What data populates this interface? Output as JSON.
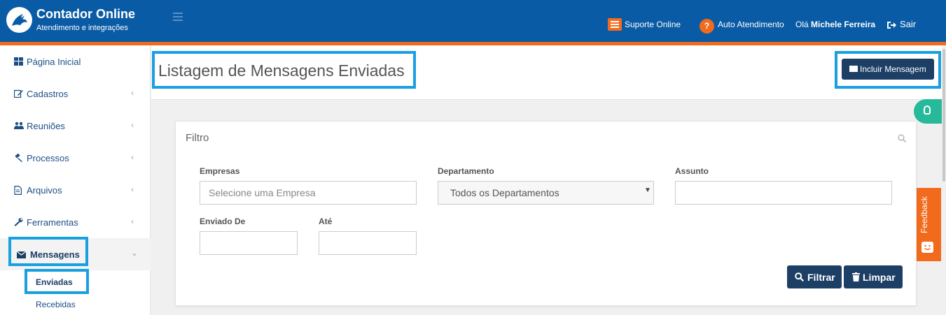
{
  "brand": {
    "title": "Contador Online",
    "subtitle": "Atendimento e integrações"
  },
  "topbar": {
    "support_label": "Suporte Online",
    "self_service_label": "Auto Atendimento",
    "help_glyph": "?",
    "greeting": "Olá",
    "user_name": "Michele Ferreira",
    "logout_label": "Sair"
  },
  "sidebar": {
    "items": [
      {
        "label": "Página Inicial",
        "icon": "dashboard-icon"
      },
      {
        "label": "Cadastros",
        "icon": "edit-icon",
        "chevron": "‹"
      },
      {
        "label": "Reuniões",
        "icon": "users-icon",
        "chevron": "‹"
      },
      {
        "label": "Processos",
        "icon": "gavel-icon",
        "chevron": "‹"
      },
      {
        "label": "Arquivos",
        "icon": "file-icon",
        "chevron": "‹"
      },
      {
        "label": "Ferramentas",
        "icon": "wrench-icon",
        "chevron": "‹"
      },
      {
        "label": "Mensagens",
        "icon": "envelope-icon",
        "chevron": "⌄"
      }
    ],
    "subitems": [
      {
        "label": "Enviadas",
        "active": true
      },
      {
        "label": "Recebidas",
        "active": false
      }
    ]
  },
  "page": {
    "title": "Listagem de Mensagens Enviadas",
    "include_button": "Incluir Mensagem"
  },
  "filter": {
    "title": "Filtro",
    "empresas_label": "Empresas",
    "empresas_placeholder": "Selecione uma Empresa",
    "departamento_label": "Departamento",
    "departamento_value": "Todos os Departamentos",
    "assunto_label": "Assunto",
    "assunto_value": "",
    "enviado_de_label": "Enviado De",
    "ate_label": "Até",
    "filtrar_button": "Filtrar",
    "limpar_button": "Limpar"
  },
  "side_tabs": {
    "feedback_label": "Feedback"
  },
  "colors": {
    "header": "#0a5ba5",
    "accent": "#f26b1d",
    "button": "#1d3f66",
    "highlight": "#1aa0e0",
    "tip_tab": "#26b99a"
  }
}
